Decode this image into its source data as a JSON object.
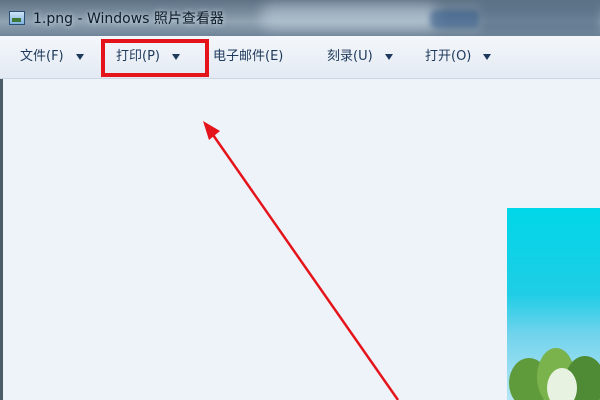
{
  "window": {
    "title": "1.png - Windows 照片查看器"
  },
  "toolbar": {
    "items": [
      {
        "label": "文件(F)",
        "has_dropdown": true
      },
      {
        "label": "打印(P)",
        "has_dropdown": true,
        "highlighted": true
      },
      {
        "label": "电子邮件(E)",
        "has_dropdown": false
      },
      {
        "label": "刻录(U)",
        "has_dropdown": true
      },
      {
        "label": "打开(O)",
        "has_dropdown": true
      }
    ]
  },
  "colors": {
    "highlight": "#e5141b",
    "annotation_arrow": "#e5141b",
    "toolbar_text": "#1e395b",
    "viewer_background": "#eef2f9"
  },
  "icons": {
    "app": "photo-viewer-icon",
    "dropdown": "chevron-down-icon"
  }
}
